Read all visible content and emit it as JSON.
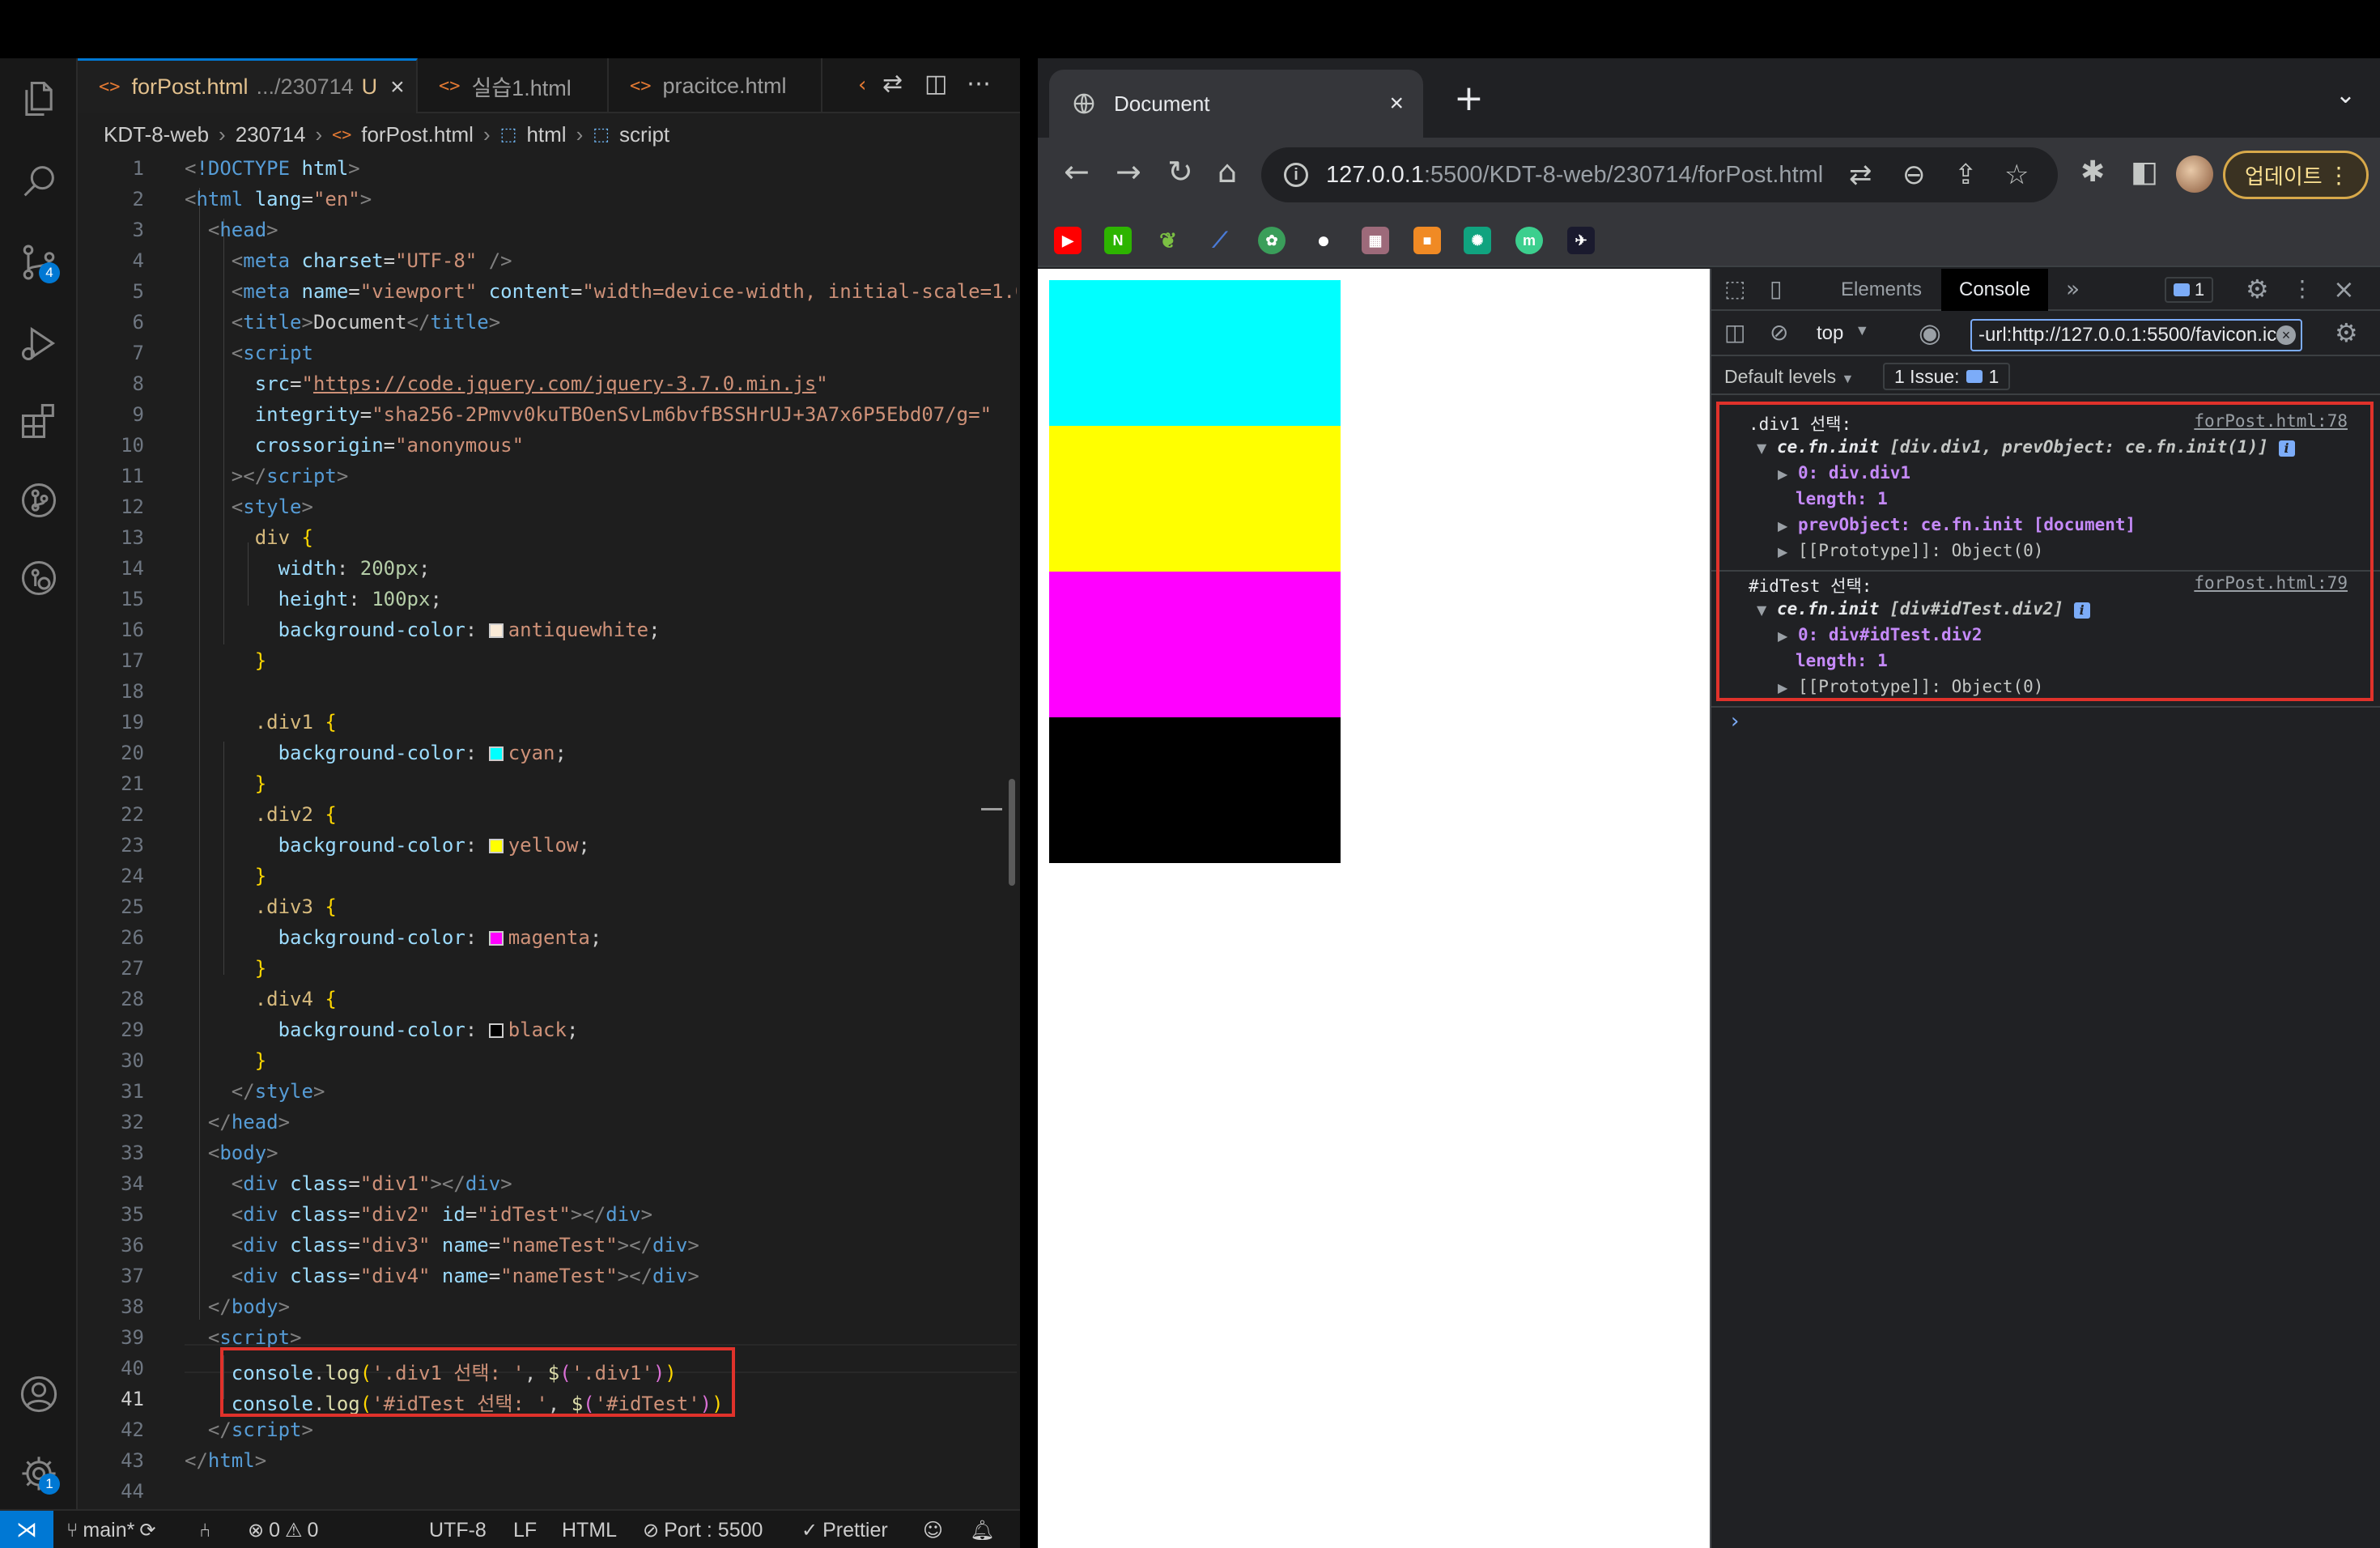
{
  "vscode": {
    "tabs": [
      {
        "label": "forPost.html",
        "description": ".../230714",
        "status": "U",
        "active": true
      },
      {
        "label": "실습1.html",
        "active": false
      },
      {
        "label": "pracitce.html",
        "active": false
      }
    ],
    "breadcrumb": [
      "KDT-8-web",
      "230714",
      "forPost.html",
      "html",
      "script"
    ],
    "activity_badges": {
      "source_control": "4",
      "settings": "1"
    },
    "code": {
      "line_count": 44,
      "current_line": 41,
      "url": "https://code.jquery.com/jquery-3.7.0.min.js",
      "integrity": "sha256-2Pmvv0kuTBOenSvLm6bvfBSSHrUJ+3A7x6P5Ebd07/g=",
      "colors": {
        "antiquewhite": "#faebd7",
        "cyan": "#00ffff",
        "yellow": "#ffff00",
        "magenta": "#ff00ff",
        "black": "#000000"
      }
    },
    "statusbar": {
      "branch": "main*",
      "errors": "0",
      "warnings": "0",
      "encoding": "UTF-8",
      "eol": "LF",
      "language": "HTML",
      "port": "Port : 5500",
      "formatter": "Prettier"
    }
  },
  "chrome": {
    "tab_title": "Document",
    "url_host": "127.0.0.1",
    "url_path": ":5500/KDT-8-web/230714/forPost.html",
    "update_label": "업데이트",
    "page_divs": [
      {
        "class": "div1",
        "color": "#00ffff"
      },
      {
        "class": "div2",
        "color": "#ffff00"
      },
      {
        "class": "div3",
        "color": "#ff00ff"
      },
      {
        "class": "div4",
        "color": "#000000"
      }
    ],
    "devtools": {
      "tabs": [
        "Elements",
        "Console"
      ],
      "active_tab": "Console",
      "issues_chip": "1",
      "context": "top",
      "filter": "-url:http://127.0.0.1:5500/favicon.ico",
      "levels": "Default levels",
      "issues": "1 Issue:",
      "issues_count": "1",
      "logs": [
        {
          "label": ".div1 선택:",
          "source": "forPost.html:78",
          "summary_fn": "ce.fn.init",
          "summary": "[div.div1, prevObject: ce.fn.init(1)]",
          "items": [
            "0: div.div1",
            "length: 1",
            "prevObject: ce.fn.init [document]",
            "[[Prototype]]: Object(0)"
          ]
        },
        {
          "label": "#idTest 선택:",
          "source": "forPost.html:79",
          "summary_fn": "ce.fn.init",
          "summary": "[div#idTest.div2]",
          "items": [
            "0: div#idTest.div2",
            "length: 1",
            "[[Prototype]]: Object(0)"
          ]
        }
      ]
    }
  }
}
